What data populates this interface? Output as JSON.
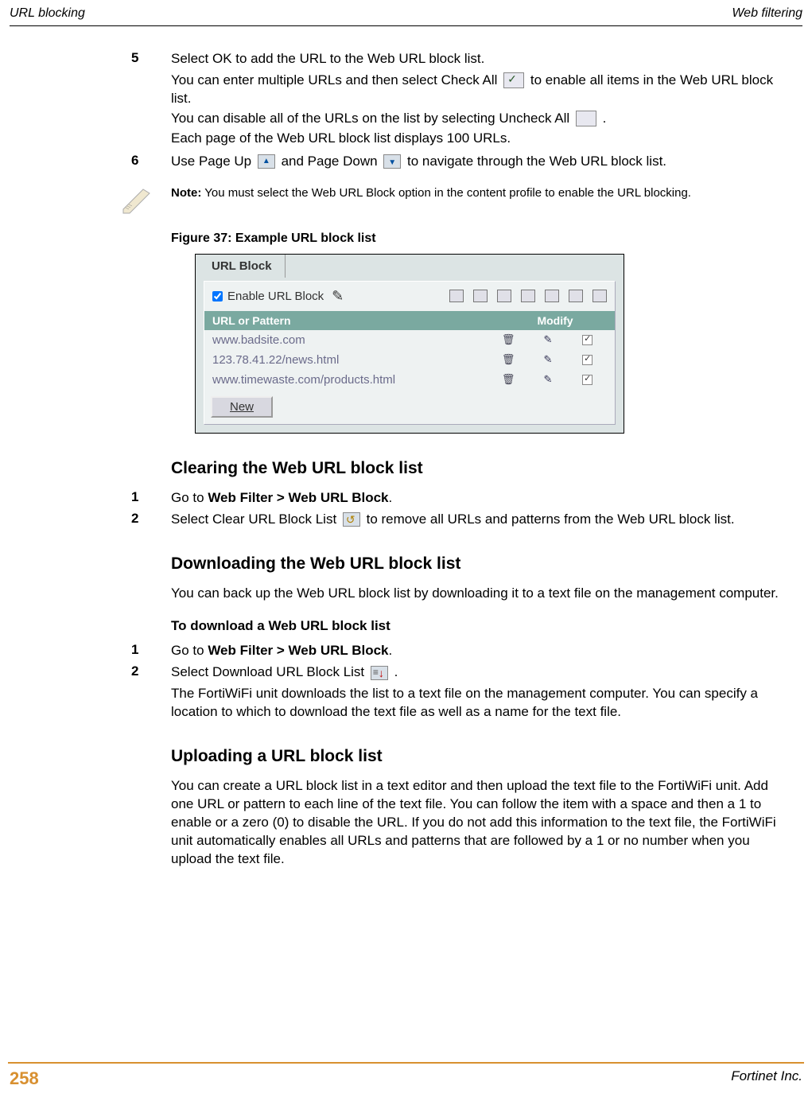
{
  "header": {
    "left": "URL blocking",
    "right": "Web filtering"
  },
  "steps": {
    "step5_num": "5",
    "step5_line1": "Select OK to add the URL to the Web URL block list.",
    "step5_line2a": "You can enter multiple URLs and then select Check All ",
    "step5_line2b": "  to enable all items in the Web URL block list.",
    "step5_line3a": "You can disable all of the URLs on the list by selecting Uncheck All ",
    "step5_line3b": " .",
    "step5_line4": "Each page of the Web URL block list displays 100 URLs.",
    "step6_num": "6",
    "step6_a": "Use Page Up ",
    "step6_b": " and Page Down ",
    "step6_c": " to navigate through the Web URL block list."
  },
  "note": {
    "label": "Note:",
    "text": " You must select the Web URL Block option in the content profile to enable the URL blocking."
  },
  "figure": {
    "caption": "Figure 37: Example URL block list",
    "tab_title": "URL Block",
    "enable_label": " Enable URL Block ",
    "col_url": "URL or Pattern",
    "col_modify": "Modify",
    "rows": [
      {
        "url": "www.badsite.com"
      },
      {
        "url": "123.78.41.22/news.html"
      },
      {
        "url": "www.timewaste.com/products.html"
      }
    ],
    "new_button": "New"
  },
  "clearing": {
    "heading": "Clearing the Web URL block list",
    "step1_num": "1",
    "step1_a": "Go to ",
    "step1_b": "Web Filter > Web URL Block",
    "step1_c": ".",
    "step2_num": "2",
    "step2_a": "Select Clear URL Block List ",
    "step2_b": " to remove all URLs and patterns from the Web URL block list."
  },
  "downloading": {
    "heading": "Downloading the Web URL block list",
    "intro": "You can back up the Web URL block list by downloading it to a text file on the management computer.",
    "sub": "To download a Web URL block list",
    "step1_num": "1",
    "step1_a": "Go to ",
    "step1_b": "Web Filter > Web URL Block",
    "step1_c": ".",
    "step2_num": "2",
    "step2_a": "Select Download URL Block List ",
    "step2_b": ".",
    "step2_cont": "The FortiWiFi unit downloads the list to a text file on the management computer. You can specify a location to which to download the text file as well as a name for the text file."
  },
  "uploading": {
    "heading": "Uploading a URL block list",
    "body": "You can create a URL block list in a text editor and then upload the text file to the FortiWiFi unit. Add one URL or pattern to each line of the text file. You can follow the item with a space and then a 1 to enable or a zero (0) to disable the URL. If you do not add this information to the text file, the FortiWiFi unit automatically enables all URLs and patterns that are followed by a 1 or no number when you upload the text file."
  },
  "footer": {
    "page": "258",
    "company": "Fortinet Inc."
  }
}
